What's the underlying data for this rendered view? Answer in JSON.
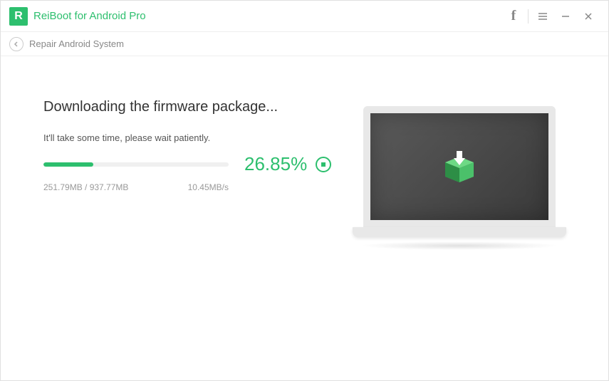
{
  "titlebar": {
    "app_name": "ReiBoot for Android Pro",
    "logo_letter": "R"
  },
  "breadcrumb": {
    "label": "Repair Android System"
  },
  "main": {
    "heading": "Downloading the firmware package...",
    "subtitle": "It'll take some time, please wait patiently.",
    "progress_percent": "26.85%",
    "progress_fill_width": "26.85%",
    "size_status": "251.79MB / 937.77MB",
    "speed": "10.45MB/s"
  },
  "colors": {
    "accent": "#2dbf6e"
  }
}
